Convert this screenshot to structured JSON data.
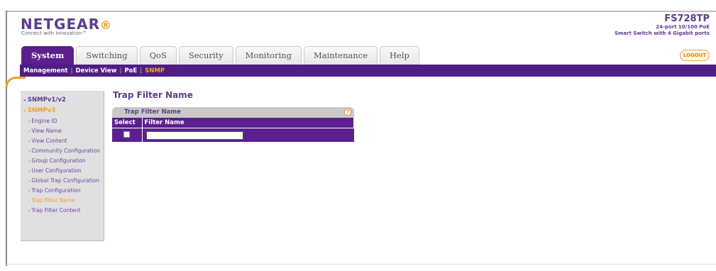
{
  "brand": {
    "logo": "NETGEAR",
    "logo_mark": "®",
    "tagline": "Connect with Innovation™"
  },
  "model": {
    "name": "FS728TP",
    "line1": "24-port 10/100 PoE",
    "line2": "Smart Switch with 4 Gigabit ports"
  },
  "tabs": [
    {
      "label": "System",
      "active": true
    },
    {
      "label": "Switching",
      "active": false
    },
    {
      "label": "QoS",
      "active": false
    },
    {
      "label": "Security",
      "active": false
    },
    {
      "label": "Monitoring",
      "active": false
    },
    {
      "label": "Maintenance",
      "active": false
    },
    {
      "label": "Help",
      "active": false
    }
  ],
  "logout_label": "LOGOUT",
  "subnav": {
    "items": [
      "Management",
      "Device View",
      "PoE",
      "SNMP"
    ],
    "separator": "|"
  },
  "sidebar": {
    "items": [
      {
        "label": "SNMPv1/v2",
        "level": 1
      },
      {
        "label": "SNMPv3",
        "level": 1
      },
      {
        "label": "Engine ID",
        "level": 2
      },
      {
        "label": "View Name",
        "level": 2
      },
      {
        "label": "View Content",
        "level": 2
      },
      {
        "label": "Community Configuration",
        "level": 2
      },
      {
        "label": "Group Configuration",
        "level": 2
      },
      {
        "label": "User Configuration",
        "level": 2
      },
      {
        "label": "Global Trap Configuration",
        "level": 2
      },
      {
        "label": "Trap Configuration",
        "level": 2
      },
      {
        "label": "Trap Filter Name",
        "level": 2
      },
      {
        "label": "Trap Filter Content",
        "level": 2
      }
    ]
  },
  "main": {
    "page_title": "Trap Filter Name",
    "panel_title": "Trap Filter Name",
    "help_icon": "help-icon",
    "columns": [
      "Select",
      "Filter Name"
    ],
    "row": {
      "filter_name_value": ""
    }
  },
  "colors": {
    "brand_purple": "#5c1f8f",
    "accent_orange": "#f0a32b"
  }
}
